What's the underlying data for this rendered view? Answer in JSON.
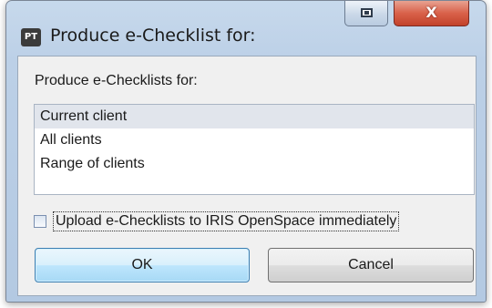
{
  "window": {
    "title": "Produce e-Checklist for:",
    "app_icon_text": "PT",
    "close_glyph": "X"
  },
  "dialog": {
    "instruction": "Produce e-Checklists for:",
    "options": [
      {
        "label": "Current client",
        "selected": true
      },
      {
        "label": "All clients",
        "selected": false
      },
      {
        "label": "Range of clients",
        "selected": false
      }
    ],
    "upload_checkbox": {
      "label": "Upload e-Checklists to IRIS OpenSpace immediately",
      "checked": false
    },
    "ok_label": "OK",
    "cancel_label": "Cancel"
  },
  "colors": {
    "close_button": "#d9614a",
    "ok_button_border": "#3c7fb1",
    "selection": "#e1e5ec"
  }
}
